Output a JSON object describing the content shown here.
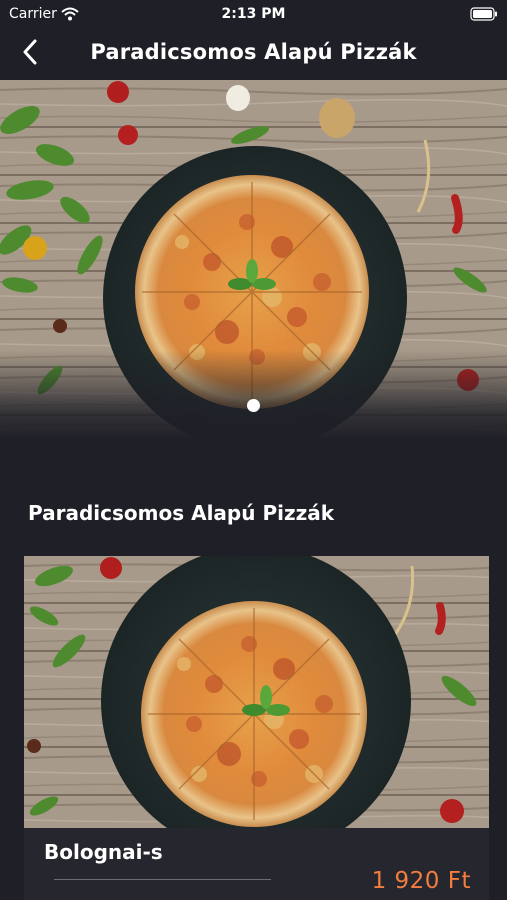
{
  "status_bar": {
    "carrier": "Carrier",
    "time": "2:13 PM",
    "icons": [
      "wifi-icon",
      "battery-icon"
    ]
  },
  "nav": {
    "title": "Paradicsomos Alapú Pizzák",
    "back_icon": "chevron-left-icon"
  },
  "hero": {
    "image": "pizza-photo",
    "page_dots": 1,
    "active_dot": 1
  },
  "section": {
    "title": "Paradicsomos Alapú Pizzák"
  },
  "products": [
    {
      "name": "Bolognai-s",
      "price": "1 920 Ft",
      "image": "pizza-photo"
    }
  ],
  "colors": {
    "background": "#1f2027",
    "card": "#26272e",
    "price": "#f27d3f",
    "text": "#ffffff"
  }
}
